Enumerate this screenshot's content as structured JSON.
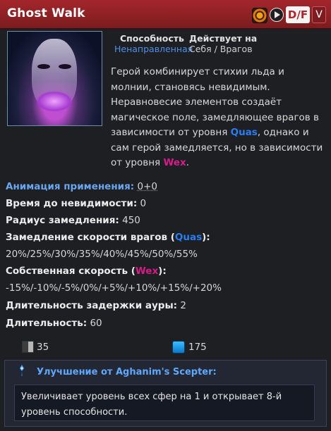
{
  "header": {
    "title": "Ghost Walk",
    "hotkey_primary": "D/F",
    "hotkey_secondary": "V",
    "colors": {
      "bar": "#9c2429",
      "key_text": "#b02328"
    }
  },
  "meta": {
    "ability_label": "Способность",
    "ability_value": "Ненаправленная",
    "affects_label": "Действует на",
    "affects_value": "Себя / Врагов"
  },
  "description": {
    "part1": "Герой комбинирует стихии льда и молнии, становясь невидимым. Неравновесие элементов создаёт магическое поле, замедляющее врагов в зависимости от уровня ",
    "quas": "Quas",
    "part2": ", однако и сам герой замедляется, но в зависимости от уровня ",
    "wex": "Wex",
    "part3": "."
  },
  "stats": {
    "cast_animation_label": "Анимация применения:",
    "cast_animation_value": "0+0",
    "fade_time_label": "Время до невидимости:",
    "fade_time_value": "0",
    "slow_radius_label": "Радиус замедления:",
    "slow_radius_value": "450",
    "enemy_slow_label_a": "Замедление скорости врагов (",
    "enemy_slow_orb": "Quas",
    "enemy_slow_label_b": "):",
    "enemy_slow_values": "20%/25%/30%/35%/40%/45%/50%/55%",
    "self_speed_label_a": "Собственная скорость (",
    "self_speed_orb": "Wex",
    "self_speed_label_b": "):",
    "self_speed_values": "-15%/-10%/-5%/0%/+5%/+10%/+15%/+20%",
    "aura_linger_label": "Длительность задержки ауры:",
    "aura_linger_value": "2",
    "duration_label": "Длительность:",
    "duration_value": "60"
  },
  "costs": {
    "cooldown": "35",
    "mana": "175"
  },
  "scepter": {
    "title": "Улучшение от Aghanim's Scepter:",
    "description": "Увеличивает уровень всех сфер на 1 и открывает 8-й уровень способности."
  }
}
